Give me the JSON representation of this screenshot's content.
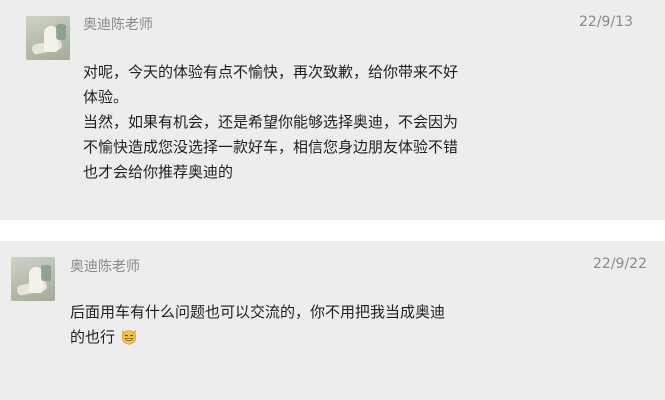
{
  "messages": [
    {
      "sender": "奥迪陈老师",
      "time": "22/9/13",
      "lines": [
        "对呢，今天的体验有点不愉快，再次致歉，给你带来不好",
        "体验。",
        "当然，如果有机会，还是希望你能够选择奥迪，不会因为",
        "不愉快造成您没选择一款好车，相信您身边朋友体验不错",
        "也才会给你推荐奥迪的"
      ]
    },
    {
      "sender": "奥迪陈老师",
      "time": "22/9/22",
      "lines": [
        "后面用车有什么问题也可以交流的，你不用把我当成奥迪",
        "的也行"
      ],
      "emoji": "grinning-cat-emoji"
    }
  ]
}
